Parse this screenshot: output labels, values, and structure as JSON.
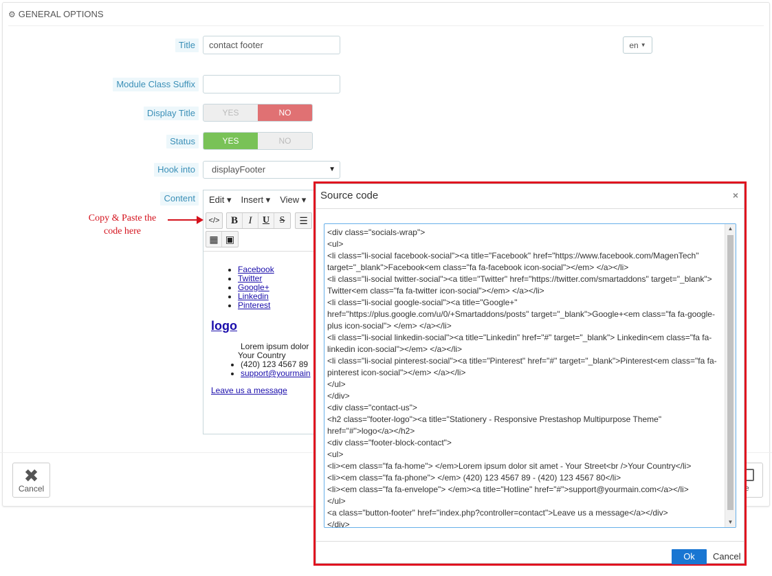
{
  "panel": {
    "heading": "GENERAL OPTIONS",
    "heading_icon": "gears-icon"
  },
  "form": {
    "title_label": "Title",
    "title_value": "contact footer",
    "lang": "en",
    "suffix_label": "Module Class Suffix",
    "suffix_value": "",
    "display_title_label": "Display Title",
    "status_label": "Status",
    "yes": "YES",
    "no": "NO",
    "hook_label": "Hook into",
    "hook_value": "displayFooter",
    "content_label": "Content"
  },
  "editor": {
    "menu": [
      "Edit",
      "Insert",
      "View"
    ],
    "social_links": [
      "Facebook",
      "Twitter",
      "Google+",
      "Linkedin",
      "Pinterest"
    ],
    "logo": "logo",
    "contact_items": [
      "Lorem ipsum dolor",
      "Your Country",
      "(420) 123 4567 89",
      "support@yourmain"
    ],
    "message_link": "Leave us a message"
  },
  "annotation": {
    "line1": "Copy & Paste the",
    "line2": "code here",
    "color": "#d4111c"
  },
  "footer": {
    "cancel": "Cancel",
    "save": "e"
  },
  "modal": {
    "title": "Source code",
    "close": "×",
    "code": "<div class=\"socials-wrap\">\n<ul>\n<li class=\"li-social facebook-social\"><a title=\"Facebook\" href=\"https://www.facebook.com/MagenTech\" target=\"_blank\">Facebook<em class=\"fa fa-facebook icon-social\"></em> </a></li>\n<li class=\"li-social twitter-social\"><a title=\"Twitter\" href=\"https://twitter.com/smartaddons\" target=\"_blank\"> Twitter<em class=\"fa fa-twitter icon-social\"></em> </a></li>\n<li class=\"li-social google-social\"><a title=\"Google+\" href=\"https://plus.google.com/u/0/+Smartaddons/posts\" target=\"_blank\">Google+<em class=\"fa fa-google-plus icon-social\"> </em> </a></li>\n<li class=\"li-social linkedin-social\"><a title=\"Linkedin\" href=\"#\" target=\"_blank\"> Linkedin<em class=\"fa fa-linkedin icon-social\"></em> </a></li>\n<li class=\"li-social pinterest-social\"><a title=\"Pinterest\" href=\"#\" target=\"_blank\">Pinterest<em class=\"fa fa-pinterest icon-social\"></em> </a></li>\n</ul>\n</div>\n<div class=\"contact-us\">\n<h2 class=\"footer-logo\"><a title=\"Stationery - Responsive Prestashop Multipurpose Theme\" href=\"#\">logo</a></h2>\n<div class=\"footer-block-contact\">\n<ul>\n<li><em class=\"fa fa-home\"> </em>Lorem ipsum dolor sit amet - Your Street<br />Your Country</li>\n<li><em class=\"fa fa-phone\"> </em> (420) 123 4567 89 - (420) 123 4567 80</li>\n<li><em class=\"fa fa-envelope\"> </em><a title=\"Hotline\" href=\"#\">support@yourmain.com</a></li>\n</ul>\n<a class=\"button-footer\" href=\"index.php?controller=contact\">Leave us a message</a></div>\n</div>",
    "ok": "Ok",
    "cancel": "Cancel"
  }
}
